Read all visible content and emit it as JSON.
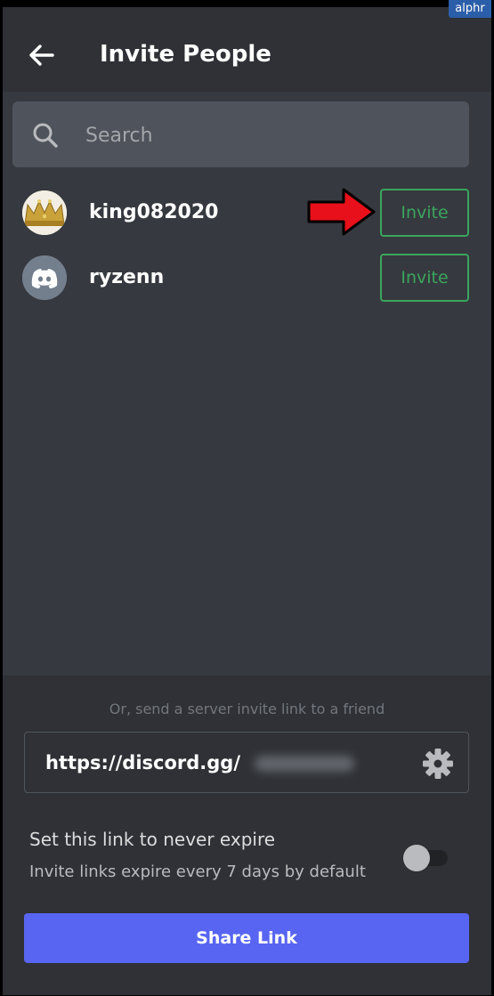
{
  "header": {
    "title": "Invite People",
    "back_icon": "arrow-left-icon"
  },
  "search": {
    "placeholder": "Search",
    "value": "",
    "icon": "search-icon"
  },
  "friends": [
    {
      "username": "king082020",
      "avatar": "crown-avatar",
      "invite_label": "Invite"
    },
    {
      "username": "ryzenn",
      "avatar": "discord-default-avatar",
      "invite_label": "Invite"
    }
  ],
  "annotation": {
    "icon": "red-arrow-icon",
    "color": "#e8101a"
  },
  "bottom": {
    "or_text": "Or, send a server invite link to a friend",
    "invite_link": "https://discord.gg/",
    "settings_icon": "gear-icon",
    "never_expire_title": "Set this link to never expire",
    "never_expire_subtitle": "Invite links expire every 7 days by default",
    "never_expire_enabled": false,
    "share_label": "Share Link"
  },
  "watermark": {
    "text": "alphr"
  },
  "colors": {
    "background": "#36393f",
    "header": "#2f3136",
    "accent_green": "#3ba55d",
    "blurple": "#5865f2"
  }
}
